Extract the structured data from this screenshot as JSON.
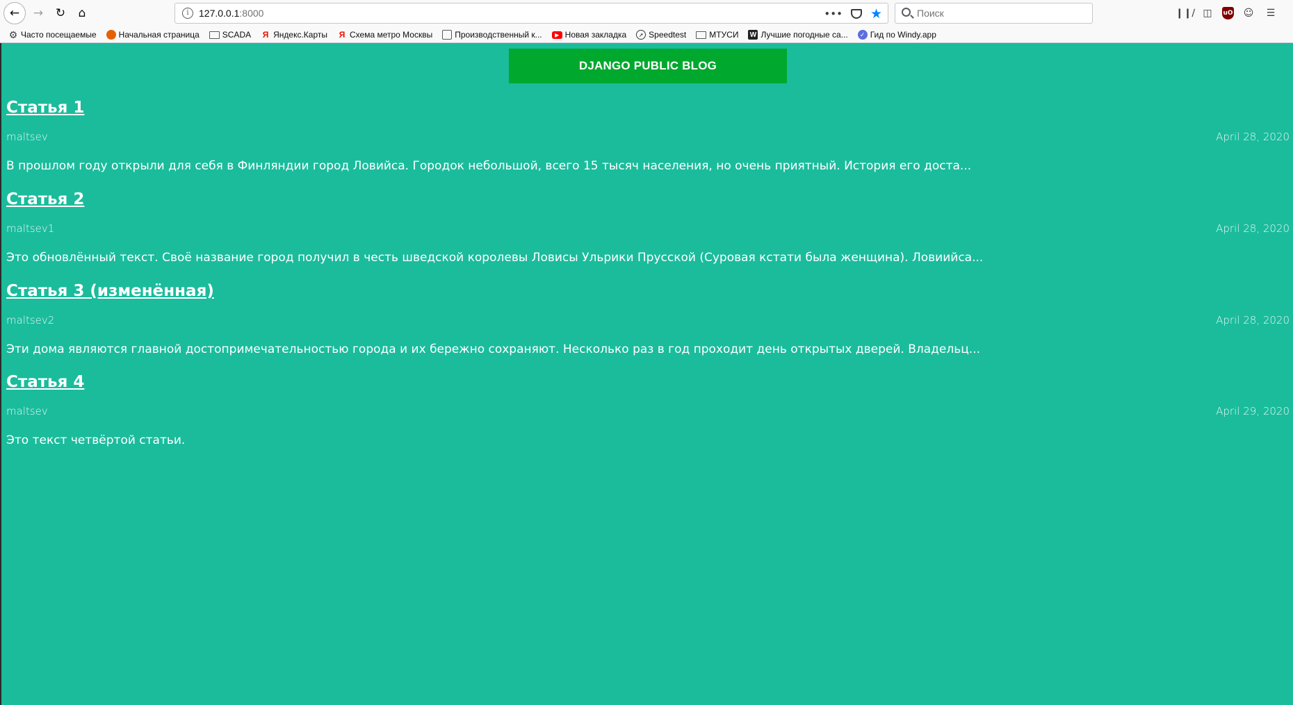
{
  "browser": {
    "url_host": "127.0.0.1",
    "url_port": ":8000",
    "search_placeholder": "Поиск",
    "bookmarks": [
      {
        "label": "Часто посещаемые",
        "icon": "gear-icon"
      },
      {
        "label": "Начальная страница",
        "icon": "firefox-icon"
      },
      {
        "label": "SCADA",
        "icon": "folder-icon"
      },
      {
        "label": "Яндекс.Карты",
        "icon": "yandex-icon"
      },
      {
        "label": "Схема метро Москвы",
        "icon": "yandex-icon"
      },
      {
        "label": "Производственный к...",
        "icon": "document-icon"
      },
      {
        "label": "Новая закладка",
        "icon": "youtube-icon"
      },
      {
        "label": "Speedtest",
        "icon": "speedometer-icon"
      },
      {
        "label": "МТУСИ",
        "icon": "folder-icon"
      },
      {
        "label": "Лучшие погодные са...",
        "icon": "w-icon"
      },
      {
        "label": "Гид по Windy.app",
        "icon": "windy-icon"
      }
    ]
  },
  "blog": {
    "header": "DJANGO PUBLIC BLOG",
    "posts": [
      {
        "title": "Статья 1",
        "author": "maltsev",
        "date": "April 28, 2020",
        "excerpt": "В прошлом году открыли для себя в Финляндии город Ловийса. Городок небольшой, всего 15 тысяч населения, но очень приятный. История его доста..."
      },
      {
        "title": "Статья 2",
        "author": "maltsev1",
        "date": "April 28, 2020",
        "excerpt": "Это обновлённый текст. Своё название город получил в честь шведской королевы Ловисы Ульрики Прусской (Суровая кстати была женщина). Ловиийса..."
      },
      {
        "title": "Статья 3 (изменённая)",
        "author": "maltsev2",
        "date": "April 28, 2020",
        "excerpt": "Эти дома являются главной достопримечательностью города и их бережно сохраняют. Несколько раз в год проходит день открытых дверей. Владельц..."
      },
      {
        "title": "Статья 4",
        "author": "maltsev",
        "date": "April 29, 2020",
        "excerpt": "Это текст четвёртой статьи."
      }
    ]
  },
  "colors": {
    "page_background": "#1abc9c",
    "header_button": "#00a82d",
    "text": "#ffffff"
  }
}
